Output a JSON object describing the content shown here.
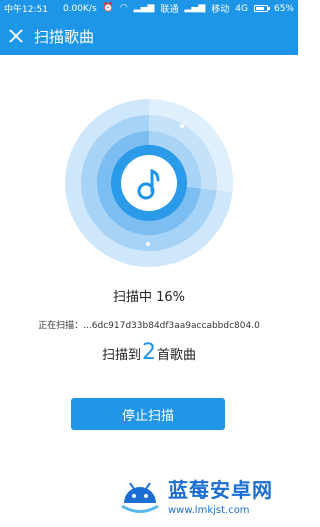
{
  "statusbar": {
    "time": "中午12:51",
    "speed": "0.00K/s",
    "carrier1": "联通",
    "carrier2": "移动",
    "network": "4G",
    "battery": "65%"
  },
  "header": {
    "title": "扫描歌曲"
  },
  "scan": {
    "status_label": "扫描中 16%",
    "progress_percent": 16,
    "scanning_label": "正在扫描：",
    "scanning_file": "...6dc917d33b84df3aa9accabbdc804.0",
    "found_prefix": "扫描到",
    "found_count": "2",
    "found_suffix": "首歌曲"
  },
  "actions": {
    "stop_label": "停止扫描"
  },
  "watermark": {
    "title": "蓝莓安卓网",
    "url": "www.lmkjst.com"
  },
  "colors": {
    "primary": "#1e96e8",
    "radar_light": "#c9e4fa",
    "radar_mid": "#5cb4ef"
  }
}
